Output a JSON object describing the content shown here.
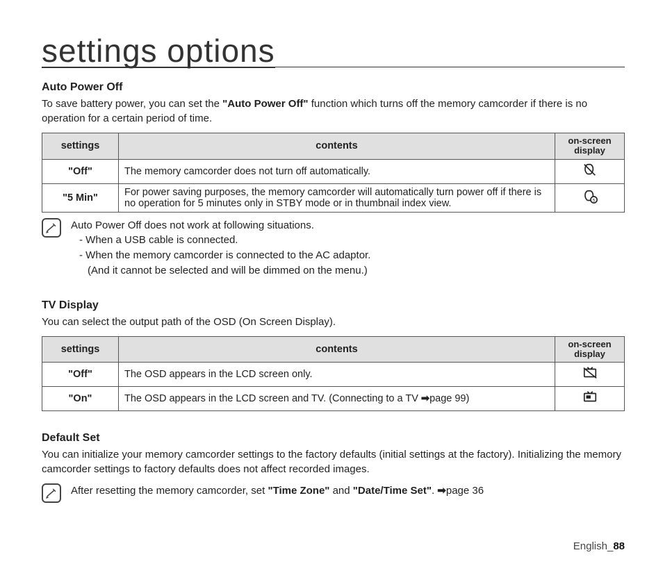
{
  "page_title": "settings options",
  "sections": {
    "auto_power_off": {
      "heading": "Auto Power Off",
      "desc_pre": "To save battery power, you can set the ",
      "desc_bold": "\"Auto Power Off\"",
      "desc_post": " function which turns off the memory camcorder if there is no operation for a certain period of time.",
      "columns": {
        "settings": "settings",
        "contents": "contents",
        "osd": "on-screen display"
      },
      "rows": [
        {
          "setting": "\"Off\"",
          "content": "The memory camcorder does not turn off automatically.",
          "icon": "auto-off-disabled-icon"
        },
        {
          "setting": "\"5 Min\"",
          "content": "For power saving purposes, the memory camcorder will automatically turn power off if there is no operation for 5 minutes only in STBY mode or in thumbnail index view.",
          "icon": "auto-off-5min-icon"
        }
      ],
      "note": {
        "line1": "Auto Power Off does not work at following situations.",
        "line2": "- When a USB cable is connected.",
        "line3": "- When the memory camcorder is connected to the AC adaptor.",
        "line4": "(And it cannot be selected and will be dimmed on the menu.)"
      }
    },
    "tv_display": {
      "heading": "TV Display",
      "desc": "You can select the output path of the OSD (On Screen Display).",
      "columns": {
        "settings": "settings",
        "contents": "contents",
        "osd": "on-screen display"
      },
      "rows": [
        {
          "setting": "\"Off\"",
          "content": "The OSD appears in the LCD screen only.",
          "icon": "tv-osd-off-icon"
        },
        {
          "setting": "\"On\"",
          "content_pre": "The OSD appears in the LCD screen and TV. (Connecting to a TV ",
          "content_post": "page 99)",
          "icon": "tv-osd-on-icon"
        }
      ]
    },
    "default_set": {
      "heading": "Default Set",
      "desc": "You can initialize your memory camcorder settings to the factory defaults (initial settings at the factory). Initializing the memory camcorder settings to factory defaults does not affect recorded images.",
      "note_pre": "After resetting the memory camcorder, set ",
      "note_b1": "\"Time Zone\"",
      "note_mid": " and ",
      "note_b2": "\"Date/Time Set\"",
      "note_post": ". ",
      "note_ref": "page 36"
    }
  },
  "footer": {
    "lang": "English",
    "sep": "_",
    "page": "88"
  }
}
